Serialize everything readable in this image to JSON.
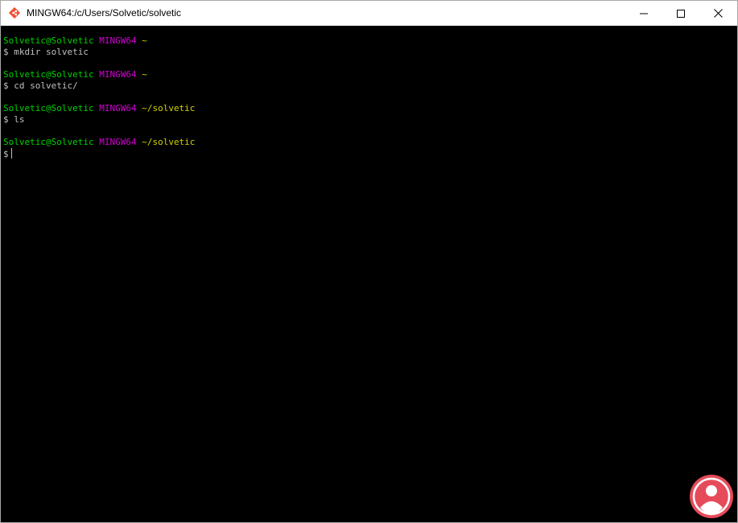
{
  "window": {
    "title": "MINGW64:/c/Users/Solvetic/solvetic",
    "icon": "git-bash-icon",
    "controls": {
      "minimize": "minimize-icon",
      "maximize": "maximize-icon",
      "close": "close-icon"
    }
  },
  "terminal": {
    "colors": {
      "user": "#00d200",
      "env": "#d200d2",
      "path": "#d2d200",
      "text": "#c0c0c0",
      "background": "#000000"
    },
    "blocks": [
      {
        "user": "Solvetic@Solvetic",
        "env": "MINGW64",
        "path": "~",
        "command": "$ mkdir solvetic"
      },
      {
        "user": "Solvetic@Solvetic",
        "env": "MINGW64",
        "path": "~",
        "command": "$ cd solvetic/"
      },
      {
        "user": "Solvetic@Solvetic",
        "env": "MINGW64",
        "path": "~/solvetic",
        "command": "$ ls"
      },
      {
        "user": "Solvetic@Solvetic",
        "env": "MINGW64",
        "path": "~/solvetic",
        "command": "$"
      }
    ]
  },
  "watermark": {
    "icon": "solvetic-logo-icon"
  }
}
